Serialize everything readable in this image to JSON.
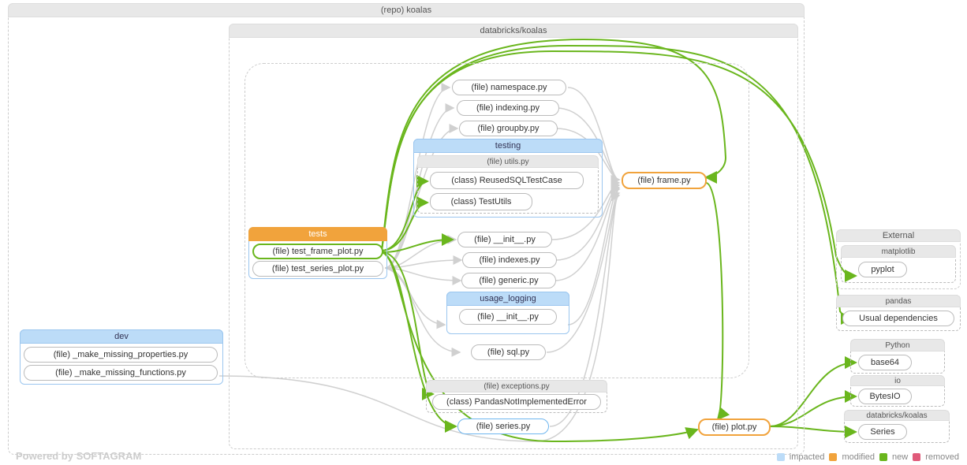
{
  "repo": {
    "label": "(repo) koalas"
  },
  "pkg": {
    "label": "databricks/koalas"
  },
  "dev": {
    "label": "dev",
    "files": [
      "(file) _make_missing_properties.py",
      "(file) _make_missing_functions.py"
    ]
  },
  "tests": {
    "label": "tests",
    "files": [
      "(file) test_frame_plot.py",
      "(file) test_series_plot.py"
    ]
  },
  "core": {
    "namespace": "(file) namespace.py",
    "indexing": "(file) indexing.py",
    "groupby": "(file) groupby.py",
    "init": "(file) __init__.py",
    "indexes": "(file) indexes.py",
    "generic": "(file) generic.py",
    "sql": "(file) sql.py",
    "frame": "(file) frame.py",
    "series": "(file) series.py",
    "plot": "(file) plot.py"
  },
  "testing": {
    "label": "testing",
    "utilsFile": "(file) utils.py",
    "classReused": "(class) ReusedSQLTestCase",
    "classUtils": "(class) TestUtils"
  },
  "usage_logging": {
    "label": "usage_logging",
    "init": "(file) __init__.py"
  },
  "exceptions": {
    "file": "(file) exceptions.py",
    "cls": "(class) PandasNotImplementedError"
  },
  "external": {
    "label": "External",
    "matplotlib": {
      "label": "matplotlib",
      "pyplot": "pyplot"
    },
    "pandas": {
      "label": "pandas",
      "deps": "Usual dependencies"
    },
    "python": {
      "label": "Python",
      "base64": "base64"
    },
    "io": {
      "label": "io",
      "bytesio": "BytesIO"
    },
    "dbkoalas": {
      "label": "databricks/koalas",
      "series": "Series"
    }
  },
  "footer": "Powered by SOFTAGRAM",
  "legend": {
    "impacted": "impacted",
    "modified": "modified",
    "new": "new",
    "removed": "removed"
  }
}
